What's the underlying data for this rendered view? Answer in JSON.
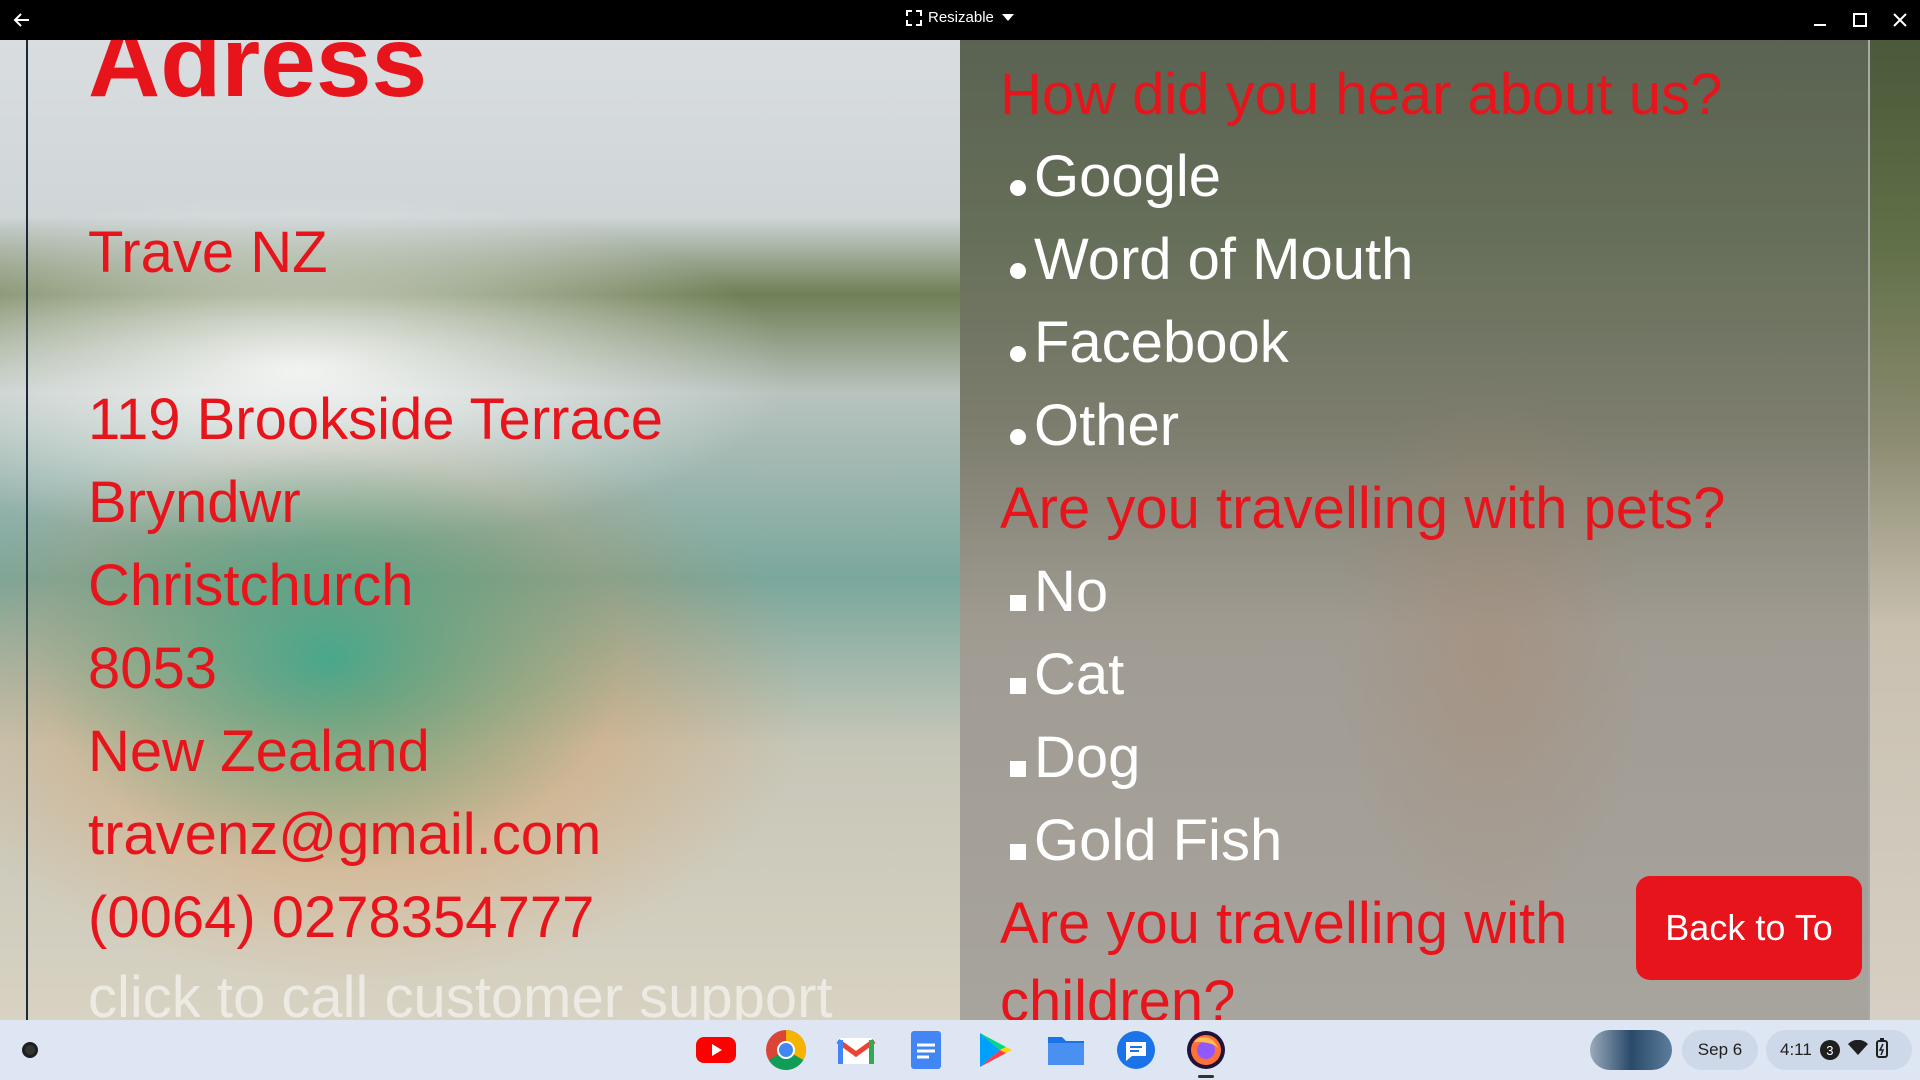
{
  "titlebar": {
    "window_mode": "Resizable"
  },
  "left": {
    "heading": "Adress",
    "lines": [
      "Trave NZ",
      "119 Brookside Terrace",
      "Bryndwr",
      "Christchurch",
      "8053",
      "New Zealand",
      "travenz@gmail.com",
      "(0064) 0278354777"
    ],
    "call_link": "click to call customer support"
  },
  "right": {
    "q1": "How did you hear about us?",
    "q1_options": [
      "Google",
      "Word of Mouth",
      "Facebook",
      "Other"
    ],
    "q2": "Are you travelling with pets?",
    "q2_options": [
      "No",
      "Cat",
      "Dog",
      "Gold Fish"
    ],
    "q3_line1": "Are you travelling with",
    "q3_line2": "children?",
    "back_button": "Back to To"
  },
  "shelf": {
    "apps": [
      "youtube-icon",
      "chrome-icon",
      "gmail-icon",
      "docs-icon",
      "play-store-icon",
      "files-icon",
      "messages-icon",
      "firefox-icon"
    ],
    "date": "Sep 6",
    "time": "4:11",
    "notification_count": "3"
  },
  "colors": {
    "accent_red": "#e8141c"
  }
}
